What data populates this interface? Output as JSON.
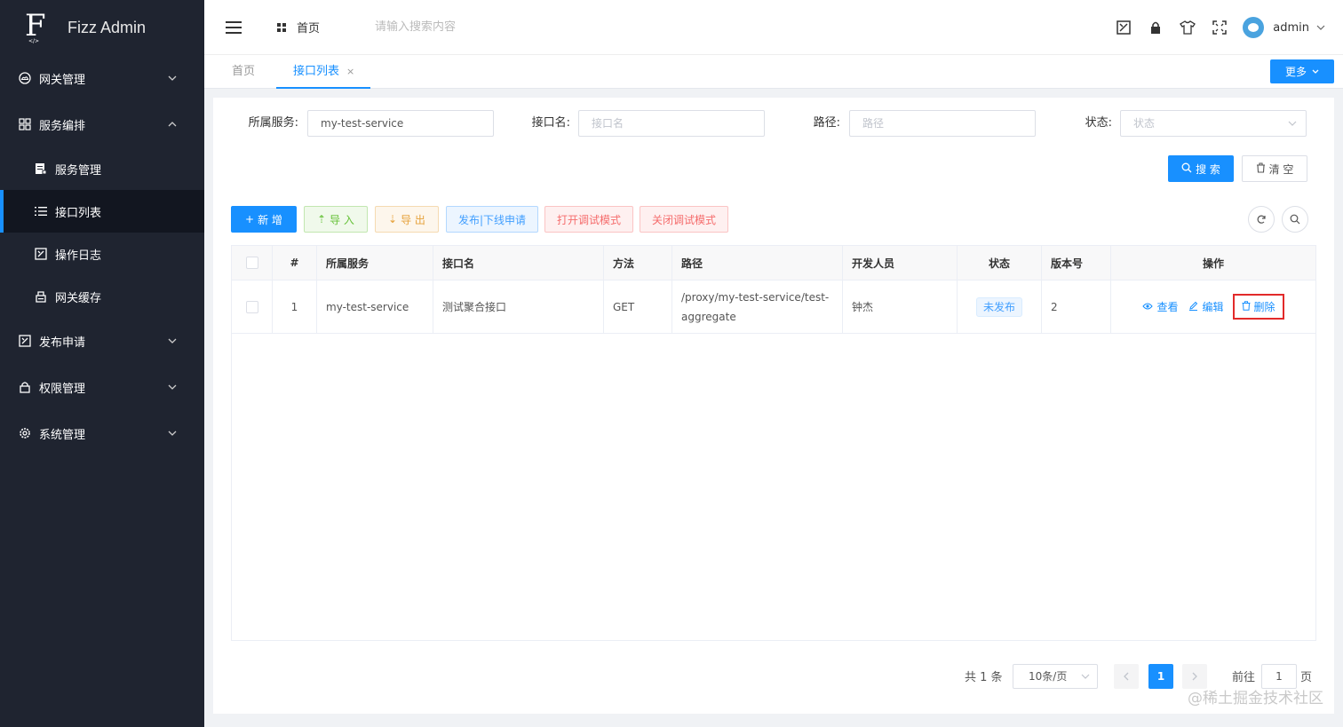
{
  "app": {
    "title": "Fizz Admin",
    "logo_tag": "</>"
  },
  "sidebar": {
    "items": [
      {
        "label": "网关管理",
        "icon": "cloud-icon",
        "expanded": false
      },
      {
        "label": "服务编排",
        "icon": "grid-icon",
        "expanded": true,
        "children": [
          {
            "label": "服务管理",
            "icon": "doc-edit-icon",
            "active": false
          },
          {
            "label": "接口列表",
            "icon": "list-icon",
            "active": true
          },
          {
            "label": "操作日志",
            "icon": "log-icon",
            "active": false
          },
          {
            "label": "网关缓存",
            "icon": "cache-icon",
            "active": false
          }
        ]
      },
      {
        "label": "发布申请",
        "icon": "publish-icon",
        "expanded": false
      },
      {
        "label": "权限管理",
        "icon": "lock-icon",
        "expanded": false
      },
      {
        "label": "系统管理",
        "icon": "gear-icon",
        "expanded": false
      }
    ]
  },
  "topbar": {
    "breadcrumb": "首页",
    "search_placeholder": "请输入搜索内容",
    "user": "admin"
  },
  "tabs": {
    "home": "首页",
    "active": "接口列表",
    "close": "×",
    "more": "更多"
  },
  "filters": {
    "service_label": "所属服务:",
    "service_value": "my-test-service",
    "api_label": "接口名:",
    "api_placeholder": "接口名",
    "path_label": "路径:",
    "path_placeholder": "路径",
    "status_label": "状态:",
    "status_placeholder": "状态",
    "search_btn": "搜 索",
    "clear_btn": "清 空"
  },
  "toolbar": {
    "add": "新 增",
    "import": "导 入",
    "export": "导 出",
    "publish": "发布|下线申请",
    "open_debug": "打开调试模式",
    "close_debug": "关闭调试模式"
  },
  "table": {
    "columns": [
      "#",
      "所属服务",
      "接口名",
      "方法",
      "路径",
      "开发人员",
      "状态",
      "版本号",
      "操作"
    ],
    "rows": [
      {
        "index": "1",
        "service": "my-test-service",
        "name": "测试聚合接口",
        "method": "GET",
        "path": "/proxy/my-test-service/test-aggregate",
        "developer": "钟杰",
        "status": "未发布",
        "version": "2"
      }
    ],
    "actions": {
      "view": "查看",
      "edit": "编辑",
      "delete": "删除"
    }
  },
  "pagination": {
    "total": "共 1 条",
    "page_size": "10条/页",
    "current": "1",
    "goto_label": "前往",
    "goto_value": "1",
    "page_label": "页"
  },
  "watermark": "@稀土掘金技术社区",
  "colors": {
    "primary": "#1890ff",
    "sidebar": "#1f2430",
    "danger_outline": "#e22a2a"
  }
}
